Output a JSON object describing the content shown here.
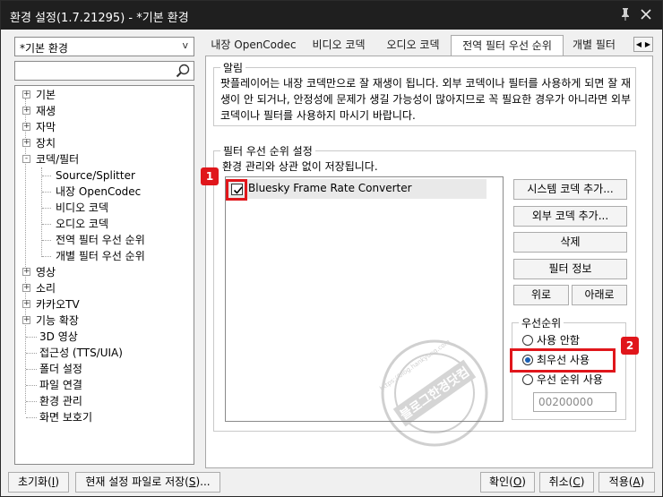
{
  "window": {
    "title": "환경 설정(1.7.21295) - *기본 환경"
  },
  "left": {
    "env_select_value": "*기본 환경",
    "env_select_arrow": "v",
    "search_value": "",
    "tree": [
      {
        "label": "기본",
        "expander": "+"
      },
      {
        "label": "재생",
        "expander": "+"
      },
      {
        "label": "자막",
        "expander": "+"
      },
      {
        "label": "장치",
        "expander": "+"
      },
      {
        "label": "코덱/필터",
        "expander": "-"
      },
      {
        "label": "Source/Splitter",
        "expander": ""
      },
      {
        "label": "내장 OpenCodec",
        "expander": ""
      },
      {
        "label": "비디오 코덱",
        "expander": ""
      },
      {
        "label": "오디오 코덱",
        "expander": ""
      },
      {
        "label": "전역 필터 우선 순위",
        "expander": ""
      },
      {
        "label": "개별 필터 우선 순위",
        "expander": ""
      },
      {
        "label": "영상",
        "expander": "+"
      },
      {
        "label": "소리",
        "expander": "+"
      },
      {
        "label": "카카오TV",
        "expander": "+"
      },
      {
        "label": "기능 확장",
        "expander": "+"
      },
      {
        "label": "3D 영상",
        "expander": ""
      },
      {
        "label": "접근성 (TTS/UIA)",
        "expander": ""
      },
      {
        "label": "폴더 설정",
        "expander": ""
      },
      {
        "label": "파일 연결",
        "expander": ""
      },
      {
        "label": "환경 관리",
        "expander": ""
      },
      {
        "label": "화면 보호기",
        "expander": ""
      }
    ]
  },
  "tabs": [
    {
      "label": "내장 OpenCodec"
    },
    {
      "label": "비디오 코덱"
    },
    {
      "label": "오디오 코덱"
    },
    {
      "label": "전역 필터 우선 순위"
    },
    {
      "label": "개별 필터"
    }
  ],
  "notice": {
    "legend": "알림",
    "text": "팟플레이어는 내장 코덱만으로 잘 재생이 됩니다. 외부 코덱이나 필터를 사용하게 되면 잘 재생이 안 되거나, 안정성에 문제가 생길 가능성이 많아지므로 꼭 필요한 경우가 아니라면 외부 코덱이나 필터를 사용하지 마시기 바랍니다."
  },
  "filter": {
    "legend": "필터 우선 순위 설정",
    "note": "환경 관리와 상관 없이 저장됩니다.",
    "items": [
      {
        "name": "Bluesky Frame Rate Converter",
        "checked": true
      }
    ],
    "buttons": {
      "add_system": "시스템 코덱 추가...",
      "add_external": "외부 코덱 추가...",
      "delete": "삭제",
      "info": "필터 정보",
      "up": "위로",
      "down": "아래로"
    }
  },
  "priority": {
    "legend": "우선순위",
    "options": [
      "사용 안함",
      "최우선 사용",
      "우선 순위 사용"
    ],
    "selected": "최우선 사용",
    "value": "00200000"
  },
  "annotations": [
    "1",
    "2"
  ],
  "watermark": {
    "lines": [
      "블로그한경닷컴",
      "https://blog.hankyung.com"
    ]
  },
  "bottom": {
    "reset": {
      "text": "초기화(",
      "key": "I",
      "end": ")"
    },
    "save_current": {
      "text": "현재 설정 파일로 저장(",
      "key": "S",
      "end": ")..."
    },
    "ok": {
      "text": "확인(",
      "key": "O",
      "end": ")"
    },
    "cancel": {
      "text": "취소(",
      "key": "C",
      "end": ")"
    },
    "apply": {
      "text": "적용(",
      "key": "A",
      "end": ")"
    }
  },
  "colors": {
    "titlebar": "#1f1f1f",
    "annotation_red": "#e0161b",
    "radio_dot": "#1a5fb4"
  }
}
